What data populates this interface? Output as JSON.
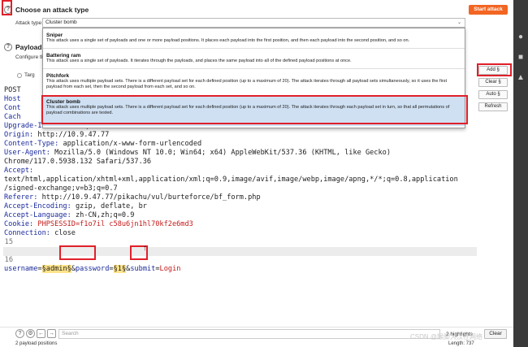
{
  "section1": {
    "help": "?",
    "title": "Choose an attack type",
    "start_label": "Start attack"
  },
  "attack_type": {
    "label": "Attack type:",
    "selected": "Cluster bomb",
    "chevron": "chevron-down-icon"
  },
  "dropdown": [
    {
      "name": "Sniper",
      "desc": "This attack uses a single set of payloads and one or more payload positions. It places each payload into the first position, and then each payload into the second position, and so on."
    },
    {
      "name": "Battering ram",
      "desc": "This attack uses a single set of payloads. It iterates through the payloads, and places the same payload into all of the defined payload positions at once."
    },
    {
      "name": "Pitchfork",
      "desc": "This attack uses multiple payload sets. There is a different payload set for each defined position (up to a maximum of 20). The attack iterates through all payload sets simultaneously, so it uses the first payload from each set, then the second payload from each set, and so on."
    },
    {
      "name": "Cluster bomb",
      "desc": "This attack uses multiple payload sets. There is a different payload set for each defined position (up to a maximum of 20). The attack iterates through each payload set in turn, so that all permutations of payload combinations are tested."
    }
  ],
  "section2": {
    "help": "?",
    "title": "Payload p",
    "configure": "Configure th",
    "target": "Targ"
  },
  "side_buttons": {
    "add": "Add §",
    "clear": "Clear §",
    "auto": "Auto §",
    "refresh": "Refresh"
  },
  "request": {
    "line1": "POST",
    "line2": "Host",
    "line3": "Cont",
    "line4": "Cach",
    "upgrade": "Upgrade-Insecure-Requests: 1",
    "origin_k": "Origin:",
    "origin_v": " http://10.9.47.77",
    "ctype_k": "Content-Type:",
    "ctype_v": " application/x-www-form-urlencoded",
    "ua_k": "User-Agent:",
    "ua_v": " Mozilla/5.0 (Windows NT 10.0; Win64; x64) AppleWebKit/537.36 (KHTML, like Gecko)",
    "ua_v2": "Chrome/117.0.5938.132 Safari/537.36",
    "accept_k": "Accept:",
    "accept_v1": "text/html,application/xhtml+xml,application/xml;q=0.9,image/avif,image/webp,image/apng,*/*;q=0.8,application",
    "accept_v2": "/signed-exchange;v=b3;q=0.7",
    "referer_k": "Referer:",
    "referer_v": " http://10.9.47.77/pikachu/vul/burteforce/bf_form.php",
    "ae_k": "Accept-Encoding:",
    "ae_v": " gzip, deflate, br",
    "al_k": "Accept-Language:",
    "al_v": " zh-CN,zh;q=0.9",
    "cookie_k": "Cookie:",
    "cookie_v": " PHPSESSID=f1o7il c58u6jn1hl70kf2e6md3",
    "conn_k": "Connection:",
    "conn_v": " close",
    "ln15": "15",
    "ln16": "16",
    "p_user": "username",
    "eq1": "=",
    "m_user": "§admin§",
    "amp1": "&",
    "p_pass": "password",
    "eq2": "=",
    "m_pass": "§1§",
    "amp2": "&",
    "p_submit": "submit",
    "eq3": "=",
    "v_submit": "Login"
  },
  "bottom": {
    "search_placeholder": "Search",
    "highlights": "2 highlights",
    "clear": "Clear",
    "status_left": "2 payload positions",
    "status_right": "Length: 737"
  },
  "watermark": "CSDN @猴脚大汉在网络"
}
